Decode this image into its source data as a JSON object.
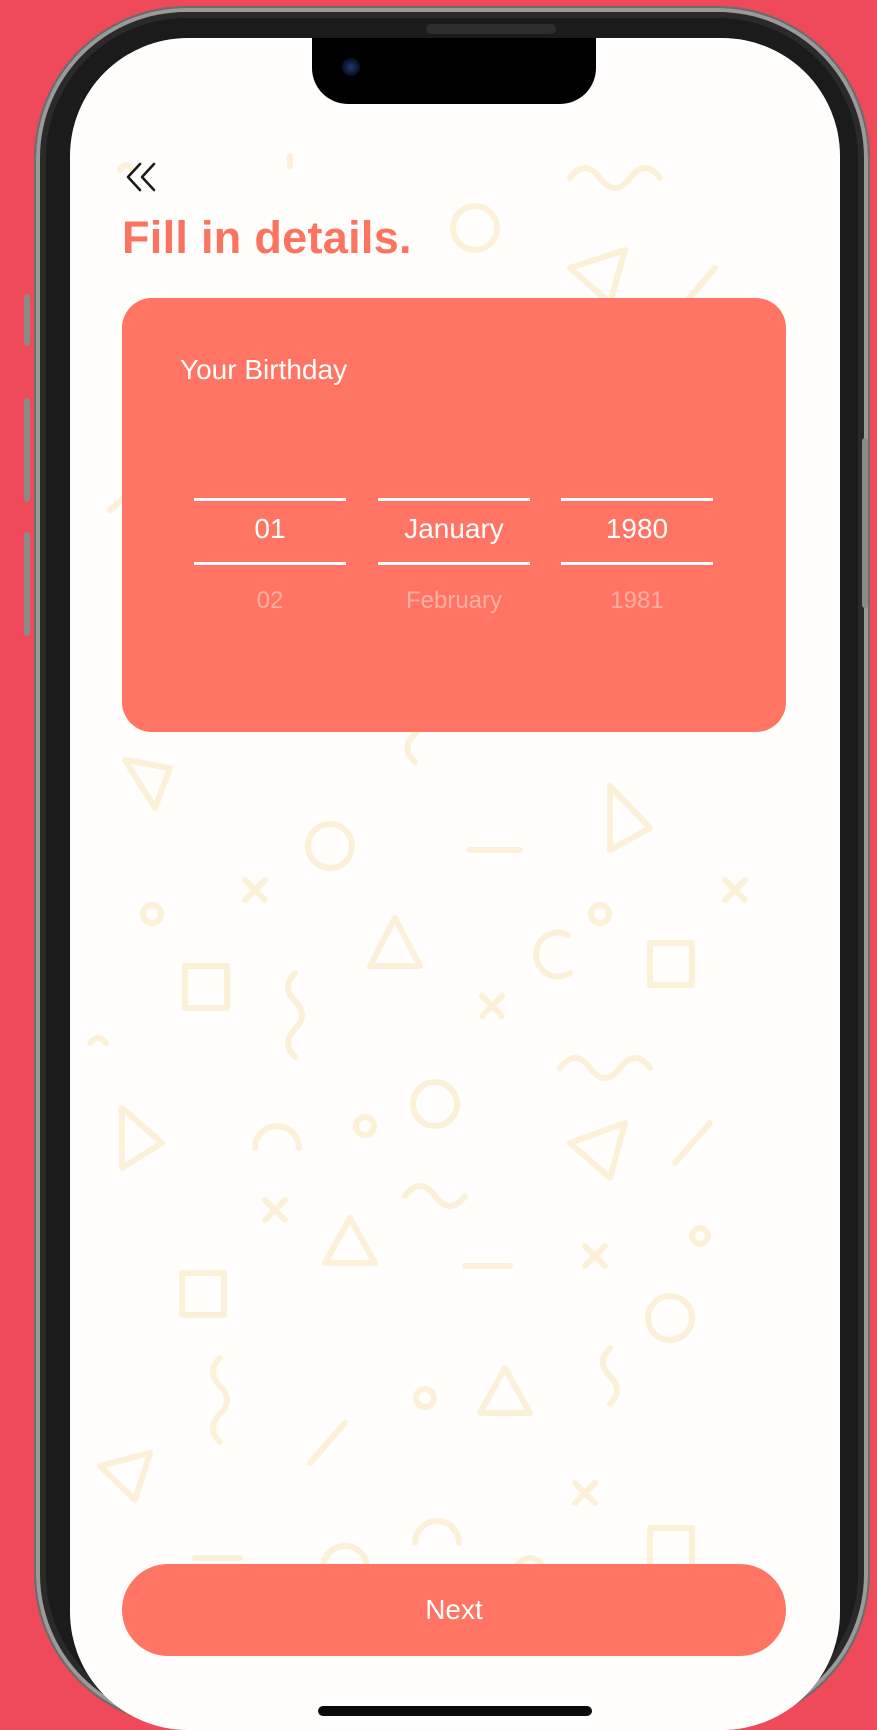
{
  "screen": {
    "title": "Fill in details.",
    "back_icon": "double-chevron-left-icon"
  },
  "birthday_card": {
    "label": "Your Birthday",
    "day": {
      "selected": "01",
      "next": "02"
    },
    "month": {
      "selected": "January",
      "next": "February"
    },
    "year": {
      "selected": "1980",
      "next": "1981"
    }
  },
  "actions": {
    "next_label": "Next"
  },
  "colors": {
    "frame_background": "#ee4a59",
    "accent": "#ff7463",
    "title": "#fe735f",
    "screen_background": "#fffefc",
    "pattern": "#fdf0d8"
  }
}
